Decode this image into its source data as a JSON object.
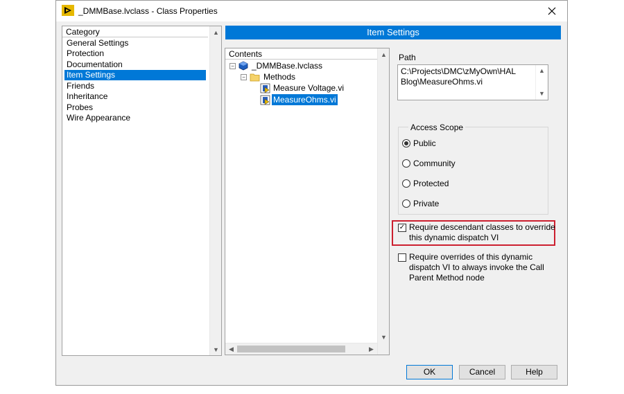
{
  "window": {
    "title": "_DMMBase.lvclass - Class Properties"
  },
  "category": {
    "header": "Category",
    "items": [
      "General Settings",
      "Protection",
      "Documentation",
      "Item Settings",
      "Friends",
      "Inheritance",
      "Probes",
      "Wire Appearance"
    ],
    "selected": "Item Settings"
  },
  "item_settings": {
    "title": "Item Settings"
  },
  "contents": {
    "header": "Contents",
    "tree": [
      {
        "label": "_DMMBase.lvclass",
        "icon": "class-icon",
        "expander": "−"
      },
      {
        "label": "Methods",
        "icon": "folder-icon",
        "expander": "−"
      },
      {
        "label": "Measure Voltage.vi",
        "icon": "vi-icon"
      },
      {
        "label": "MeasureOhms.vi",
        "icon": "vi-icon",
        "selected": true
      }
    ]
  },
  "path": {
    "label": "Path",
    "value": "C:\\Projects\\DMC\\zMyOwn\\HAL Blog\\MeasureOhms.vi"
  },
  "access_scope": {
    "title": "Access Scope",
    "options": [
      "Public",
      "Community",
      "Protected",
      "Private"
    ],
    "selected": "Public"
  },
  "checkboxes": {
    "require_override": {
      "label": "Require descendant classes to override this dynamic dispatch VI",
      "checked": true
    },
    "require_call_parent": {
      "label": "Require overrides of this dynamic dispatch VI to always invoke the Call Parent Method node",
      "checked": false
    }
  },
  "buttons": {
    "ok": "OK",
    "cancel": "Cancel",
    "help": "Help"
  },
  "colors": {
    "accent": "#0078d7",
    "highlight": "#cc1f2f"
  }
}
